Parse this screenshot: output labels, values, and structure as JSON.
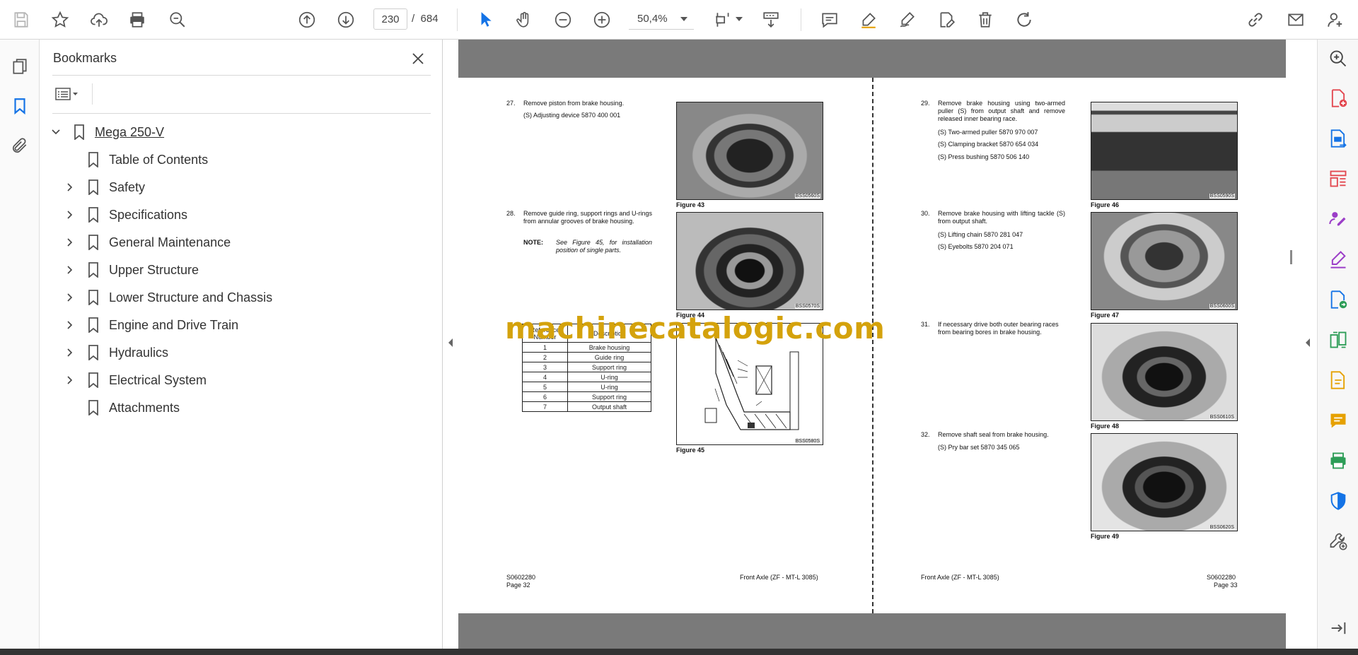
{
  "toolbar": {
    "page_current": "230",
    "page_separator": "/",
    "page_total": "684",
    "zoom": "50,4%",
    "icons": [
      "save-icon",
      "star-icon",
      "upload-icon",
      "print-icon",
      "zoom-search-icon",
      "prev-page-icon",
      "next-page-icon",
      "select-cursor-icon",
      "hand-icon",
      "zoom-out-icon",
      "zoom-in-icon",
      "fit-page-icon",
      "scroll-mode-icon",
      "comment-icon",
      "highlight-icon",
      "sign-icon",
      "edit-pdf-icon",
      "delete-icon",
      "rotate-icon",
      "share-link-icon",
      "mail-icon",
      "account-icon"
    ]
  },
  "bookmarks": {
    "title": "Bookmarks",
    "items": [
      {
        "label": "Mega 250-V",
        "level": 0,
        "expandable": true,
        "expanded": true
      },
      {
        "label": "Table of Contents",
        "level": 1,
        "expandable": false
      },
      {
        "label": "Safety",
        "level": 1,
        "expandable": true
      },
      {
        "label": "Specifications",
        "level": 1,
        "expandable": true
      },
      {
        "label": "General Maintenance",
        "level": 1,
        "expandable": true
      },
      {
        "label": "Upper Structure",
        "level": 1,
        "expandable": true
      },
      {
        "label": "Lower Structure and Chassis",
        "level": 1,
        "expandable": true
      },
      {
        "label": "Engine and Drive Train",
        "level": 1,
        "expandable": true
      },
      {
        "label": "Hydraulics",
        "level": 1,
        "expandable": true
      },
      {
        "label": "Electrical System",
        "level": 1,
        "expandable": true
      },
      {
        "label": "Attachments",
        "level": 1,
        "expandable": false
      }
    ]
  },
  "left_page": {
    "step27_num": "27.",
    "step27_text": "Remove piston from brake housing.",
    "step27_sub": "(S) Adjusting device 5870 400 001",
    "step28_num": "28.",
    "step28_text": "Remove guide ring, support rings and U-rings from annular grooves of brake housing.",
    "note_label": "NOTE:",
    "note_text": "See Figure 45, for installation position of single parts.",
    "fig43": "Figure 43",
    "fig43_code": "BSS0560S",
    "fig44": "Figure 44",
    "fig44_code": "BSS0570S",
    "fig45": "Figure 45",
    "fig45_code": "BSS0580S",
    "table_header_ref": "Reference Number",
    "table_header_desc": "Description",
    "table_rows": [
      {
        "n": "1",
        "d": "Brake housing"
      },
      {
        "n": "2",
        "d": "Guide ring"
      },
      {
        "n": "3",
        "d": "Support ring"
      },
      {
        "n": "4",
        "d": "U-ring"
      },
      {
        "n": "5",
        "d": "U-ring"
      },
      {
        "n": "6",
        "d": "Support ring"
      },
      {
        "n": "7",
        "d": "Output shaft"
      }
    ],
    "footer_code": "S0602280",
    "footer_page": "Page 32",
    "footer_title": "Front Axle (ZF - MT-L 3085)"
  },
  "right_page": {
    "step29_num": "29.",
    "step29_text": "Remove brake housing using two-armed puller (S) from output shaft and remove released inner bearing race.",
    "step29_sub1": "(S) Two-armed puller 5870 970 007",
    "step29_sub2": "(S) Clamping bracket 5870 654 034",
    "step29_sub3": "(S) Press bushing 5870 506 140",
    "step30_num": "30.",
    "step30_text": "Remove brake housing with lifting tackle (S) from output shaft.",
    "step30_sub1": "(S) Lifting chain 5870 281 047",
    "step30_sub2": "(S) Eyebolts 5870 204 071",
    "step31_num": "31.",
    "step31_text": "If necessary drive both outer bearing races from bearing bores in brake housing.",
    "step32_num": "32.",
    "step32_text": "Remove shaft seal from brake housing.",
    "step32_sub": "(S) Pry bar set 5870 345 065",
    "fig46": "Figure 46",
    "fig46_code": "BSS0590S",
    "fig47": "Figure 47",
    "fig47_code": "BSS0600S",
    "fig48": "Figure 48",
    "fig48_code": "BSS0610S",
    "fig49": "Figure 49",
    "fig49_code": "BSS0620S",
    "footer_title": "Front Axle (ZF - MT-L 3085)",
    "footer_code": "S0602280",
    "footer_page": "Page 33"
  },
  "watermark": "machinecatalogic.com",
  "colors": {
    "accent_blue": "#1473e6",
    "tool_red": "#e34850",
    "tool_purple": "#9b3ec8",
    "tool_yellow": "#e6a100",
    "tool_green": "#2d9d57",
    "watermark": "#d4a20c"
  }
}
